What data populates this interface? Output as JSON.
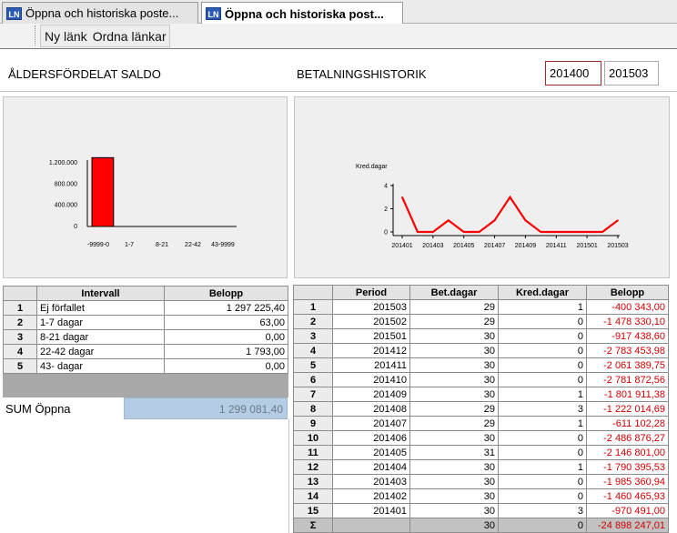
{
  "tabs": [
    {
      "icon": "LN",
      "label": "Öppna och historiska poste..."
    },
    {
      "icon": "LN",
      "label": "Öppna och historiska post..."
    }
  ],
  "toolbar": {
    "links": [
      "Ny länk",
      "Ordna länkar"
    ]
  },
  "aging": {
    "title": "ÅLDERSFÖRDELAT SALDO",
    "chart_data": {
      "type": "bar",
      "categories": [
        "-9999-0",
        "1-7",
        "8-21",
        "22-42",
        "43-9999"
      ],
      "values": [
        1297225.4,
        63.0,
        0.0,
        1793.0,
        0.0
      ],
      "ylim": [
        0,
        1200000
      ],
      "yticks": [
        0,
        400000,
        800000,
        1200000
      ],
      "ytick_labels": [
        "0",
        "400.000",
        "800.000",
        "1.200.000"
      ],
      "bar_color": "#ff0000"
    },
    "table": {
      "headers": [
        "Intervall",
        "Belopp"
      ],
      "rows": [
        {
          "n": "1",
          "interval": "Ej förfallet",
          "amount": "1 297 225,40"
        },
        {
          "n": "2",
          "interval": "1-7   dagar",
          "amount": "63,00"
        },
        {
          "n": "3",
          "interval": "8-21 dagar",
          "amount": "0,00"
        },
        {
          "n": "4",
          "interval": "22-42 dagar",
          "amount": "1 793,00"
        },
        {
          "n": "5",
          "interval": "43-   dagar",
          "amount": "0,00"
        }
      ]
    },
    "sum_label": "SUM Öppna",
    "sum_value": "1 299 081,40"
  },
  "history": {
    "title": "BETALNINGSHISTORIK",
    "period_from": "201400",
    "period_to": "201503",
    "chart_data": {
      "type": "line",
      "ylabel": "Kred.dagar",
      "x": [
        "201401",
        "201402",
        "201403",
        "201404",
        "201405",
        "201406",
        "201407",
        "201408",
        "201409",
        "201410",
        "201411",
        "201412",
        "201501",
        "201502",
        "201503"
      ],
      "xtick_labels": [
        "201401",
        "201403",
        "201405",
        "201407",
        "201409",
        "201411",
        "201501",
        "201503"
      ],
      "values": [
        3,
        0,
        0,
        1,
        0,
        0,
        1,
        3,
        1,
        0,
        0,
        0,
        0,
        0,
        1
      ],
      "ylim": [
        0,
        4
      ],
      "yticks": [
        0,
        2,
        4
      ],
      "line_color": "#ff0000"
    },
    "table": {
      "headers": [
        "Period",
        "Bet.dagar",
        "Kred.dagar",
        "Belopp"
      ],
      "rows": [
        {
          "n": "1",
          "period": "201503",
          "bet": "29",
          "kred": "1",
          "amount": "-400 343,00"
        },
        {
          "n": "2",
          "period": "201502",
          "bet": "29",
          "kred": "0",
          "amount": "-1 478 330,10"
        },
        {
          "n": "3",
          "period": "201501",
          "bet": "30",
          "kred": "0",
          "amount": "-917 438,60"
        },
        {
          "n": "4",
          "period": "201412",
          "bet": "30",
          "kred": "0",
          "amount": "-2 783 453,98"
        },
        {
          "n": "5",
          "period": "201411",
          "bet": "30",
          "kred": "0",
          "amount": "-2 061 389,75"
        },
        {
          "n": "6",
          "period": "201410",
          "bet": "30",
          "kred": "0",
          "amount": "-2 781 872,56"
        },
        {
          "n": "7",
          "period": "201409",
          "bet": "30",
          "kred": "1",
          "amount": "-1 801 911,38"
        },
        {
          "n": "8",
          "period": "201408",
          "bet": "29",
          "kred": "3",
          "amount": "-1 222 014,69"
        },
        {
          "n": "9",
          "period": "201407",
          "bet": "29",
          "kred": "1",
          "amount": "-611 102,28"
        },
        {
          "n": "10",
          "period": "201406",
          "bet": "30",
          "kred": "0",
          "amount": "-2 486 876,27"
        },
        {
          "n": "11",
          "period": "201405",
          "bet": "31",
          "kred": "0",
          "amount": "-2 146 801,00"
        },
        {
          "n": "12",
          "period": "201404",
          "bet": "30",
          "kred": "1",
          "amount": "-1 790 395,53"
        },
        {
          "n": "13",
          "period": "201403",
          "bet": "30",
          "kred": "0",
          "amount": "-1 985 360,94"
        },
        {
          "n": "14",
          "period": "201402",
          "bet": "30",
          "kred": "0",
          "amount": "-1 460 465,93"
        },
        {
          "n": "15",
          "period": "201401",
          "bet": "30",
          "kred": "3",
          "amount": "-970 491,00"
        }
      ],
      "sum": {
        "symbol": "Σ",
        "bet": "30",
        "kred": "0",
        "amount": "-24 898 247,01"
      }
    }
  }
}
